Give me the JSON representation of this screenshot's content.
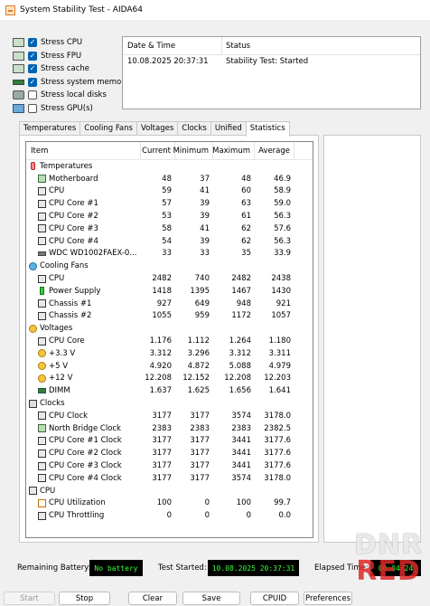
{
  "window": {
    "title": "System Stability Test - AIDA64"
  },
  "stress_options": [
    {
      "label": "Stress CPU",
      "checked": true
    },
    {
      "label": "Stress FPU",
      "checked": true
    },
    {
      "label": "Stress cache",
      "checked": true
    },
    {
      "label": "Stress system memory",
      "checked": true
    },
    {
      "label": "Stress local disks",
      "checked": false
    },
    {
      "label": "Stress GPU(s)",
      "checked": false
    }
  ],
  "log": {
    "headers": [
      "Date & Time",
      "Status"
    ],
    "rows": [
      {
        "datetime": "10.08.2025 20:37:31",
        "status": "Stability Test: Started"
      }
    ]
  },
  "tabs": [
    "Temperatures",
    "Cooling Fans",
    "Voltages",
    "Clocks",
    "Unified",
    "Statistics"
  ],
  "active_tab": "Statistics",
  "stats": {
    "columns": [
      "Item",
      "Current",
      "Minimum",
      "Maximum",
      "Average"
    ],
    "rows": [
      {
        "type": "group",
        "icon": "thermometer-icon",
        "item": "Temperatures"
      },
      {
        "type": "sub",
        "icon": "motherboard-icon",
        "item": "Motherboard",
        "current": "48",
        "min": "37",
        "max": "48",
        "avg": "46.9"
      },
      {
        "type": "sub",
        "icon": "cpu-chip-icon",
        "item": "CPU",
        "current": "59",
        "min": "41",
        "max": "60",
        "avg": "58.9"
      },
      {
        "type": "sub",
        "icon": "cpu-chip-icon",
        "item": "CPU Core #1",
        "current": "57",
        "min": "39",
        "max": "63",
        "avg": "59.0"
      },
      {
        "type": "sub",
        "icon": "cpu-chip-icon",
        "item": "CPU Core #2",
        "current": "53",
        "min": "39",
        "max": "61",
        "avg": "56.3"
      },
      {
        "type": "sub",
        "icon": "cpu-chip-icon",
        "item": "CPU Core #3",
        "current": "58",
        "min": "41",
        "max": "62",
        "avg": "57.6"
      },
      {
        "type": "sub",
        "icon": "cpu-chip-icon",
        "item": "CPU Core #4",
        "current": "54",
        "min": "39",
        "max": "62",
        "avg": "56.3"
      },
      {
        "type": "sub",
        "icon": "hard-disk-icon",
        "item": "WDC WD1002FAEX-0...",
        "current": "33",
        "min": "33",
        "max": "35",
        "avg": "33.9"
      },
      {
        "type": "group",
        "icon": "fan-icon",
        "item": "Cooling Fans"
      },
      {
        "type": "sub",
        "icon": "cpu-chip-icon",
        "item": "CPU",
        "current": "2482",
        "min": "740",
        "max": "2482",
        "avg": "2438"
      },
      {
        "type": "sub",
        "icon": "power-supply-icon",
        "item": "Power Supply",
        "current": "1418",
        "min": "1395",
        "max": "1467",
        "avg": "1430"
      },
      {
        "type": "sub",
        "icon": "blank-icon",
        "item": "Chassis #1",
        "current": "927",
        "min": "649",
        "max": "948",
        "avg": "921"
      },
      {
        "type": "sub",
        "icon": "blank-icon",
        "item": "Chassis #2",
        "current": "1055",
        "min": "959",
        "max": "1172",
        "avg": "1057"
      },
      {
        "type": "group",
        "icon": "voltage-icon",
        "item": "Voltages"
      },
      {
        "type": "sub",
        "icon": "cpu-chip-icon",
        "item": "CPU Core",
        "current": "1.176",
        "min": "1.112",
        "max": "1.264",
        "avg": "1.180"
      },
      {
        "type": "sub",
        "icon": "voltage-icon",
        "item": "+3.3 V",
        "current": "3.312",
        "min": "3.296",
        "max": "3.312",
        "avg": "3.311"
      },
      {
        "type": "sub",
        "icon": "voltage-icon",
        "item": "+5 V",
        "current": "4.920",
        "min": "4.872",
        "max": "5.088",
        "avg": "4.979"
      },
      {
        "type": "sub",
        "icon": "voltage-icon",
        "item": "+12 V",
        "current": "12.208",
        "min": "12.152",
        "max": "12.208",
        "avg": "12.203"
      },
      {
        "type": "sub",
        "icon": "memory-module-icon",
        "item": "DIMM",
        "current": "1.637",
        "min": "1.625",
        "max": "1.656",
        "avg": "1.641"
      },
      {
        "type": "group",
        "icon": "clock-icon",
        "item": "Clocks"
      },
      {
        "type": "sub",
        "icon": "cpu-chip-icon",
        "item": "CPU Clock",
        "current": "3177",
        "min": "3177",
        "max": "3574",
        "avg": "3178.0"
      },
      {
        "type": "sub",
        "icon": "motherboard-icon",
        "item": "North Bridge Clock",
        "current": "2383",
        "min": "2383",
        "max": "2383",
        "avg": "2382.5"
      },
      {
        "type": "sub",
        "icon": "cpu-chip-icon",
        "item": "CPU Core #1 Clock",
        "current": "3177",
        "min": "3177",
        "max": "3441",
        "avg": "3177.6"
      },
      {
        "type": "sub",
        "icon": "cpu-chip-icon",
        "item": "CPU Core #2 Clock",
        "current": "3177",
        "min": "3177",
        "max": "3441",
        "avg": "3177.6"
      },
      {
        "type": "sub",
        "icon": "cpu-chip-icon",
        "item": "CPU Core #3 Clock",
        "current": "3177",
        "min": "3177",
        "max": "3441",
        "avg": "3177.6"
      },
      {
        "type": "sub",
        "icon": "cpu-chip-icon",
        "item": "CPU Core #4 Clock",
        "current": "3177",
        "min": "3177",
        "max": "3574",
        "avg": "3178.0"
      },
      {
        "type": "group",
        "icon": "cpu-chip-icon",
        "item": "CPU"
      },
      {
        "type": "sub",
        "icon": "hourglass-icon",
        "item": "CPU Utilization",
        "current": "100",
        "min": "0",
        "max": "100",
        "avg": "99.7"
      },
      {
        "type": "sub",
        "icon": "cpu-chip-icon",
        "item": "CPU Throttling",
        "current": "0",
        "min": "0",
        "max": "0",
        "avg": "0.0"
      }
    ]
  },
  "status_bar": {
    "remaining_battery_label": "Remaining Battery:",
    "remaining_battery_value": "No battery",
    "test_started_label": "Test Started:",
    "test_started_value": "10.08.2025 20:37:31",
    "elapsed_time_label": "Elapsed Time:",
    "elapsed_time_value": "00:04:24"
  },
  "buttons": {
    "start": "Start",
    "stop": "Stop",
    "clear": "Clear",
    "save": "Save",
    "cpuid": "CPUID",
    "preferences": "Preferences"
  },
  "watermark": {
    "line1": "DNR",
    "line2": "RED"
  }
}
